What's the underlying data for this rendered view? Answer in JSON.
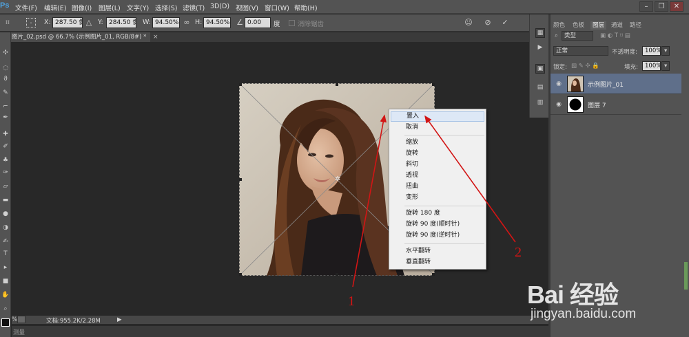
{
  "menubar": {
    "logo": "Ps",
    "items": [
      "文件(F)",
      "编辑(E)",
      "图像(I)",
      "图层(L)",
      "文字(Y)",
      "选择(S)",
      "滤镜(T)",
      "3D(D)",
      "视图(V)",
      "窗口(W)",
      "帮助(H)"
    ],
    "window_buttons": [
      "–",
      "❐",
      "✕"
    ]
  },
  "options": {
    "x_label": "X:",
    "x_value": "287.50 像",
    "y_label": "Y:",
    "y_value": "284.50 像",
    "w_label": "W:",
    "w_value": "94.50%",
    "h_label": "H:",
    "h_value": "94.50%",
    "angle_value": "0.00",
    "degree_label": "度",
    "antialias_label": "消除锯齿"
  },
  "document": {
    "tab_title": "图片_02.psd @ 66.7% (示例图片_01, RGB/8#) *",
    "tab_close": "×",
    "status_text": "文档:955.2K/2.28M",
    "bottom_text": "测量"
  },
  "context_menu": {
    "items": [
      "置入",
      "取消",
      "缩放",
      "旋转",
      "斜切",
      "透视",
      "扭曲",
      "变形",
      "旋转 180 度",
      "旋转 90 度(顺时针)",
      "旋转 90 度(逆时针)",
      "水平翻转",
      "垂直翻转"
    ],
    "selected": "置入"
  },
  "panel": {
    "tabs": [
      "颜色",
      "色板",
      "图层",
      "通道",
      "路径"
    ],
    "active_tab": "图层",
    "kind_filter": "类型",
    "blend_mode": "正常",
    "opacity_label": "不透明度:",
    "opacity_value": "100%",
    "lock_label": "锁定:",
    "fill_label": "填充:",
    "fill_value": "100%",
    "layers": [
      {
        "name": "示例图片_01",
        "selected": true
      },
      {
        "name": "图层 7",
        "selected": false
      }
    ]
  },
  "annotations": {
    "label_1": "1",
    "label_2": "2",
    "color": "#d21515"
  },
  "watermark": {
    "main": "Bai 经验",
    "sub": "jingyan.baidu.com"
  }
}
